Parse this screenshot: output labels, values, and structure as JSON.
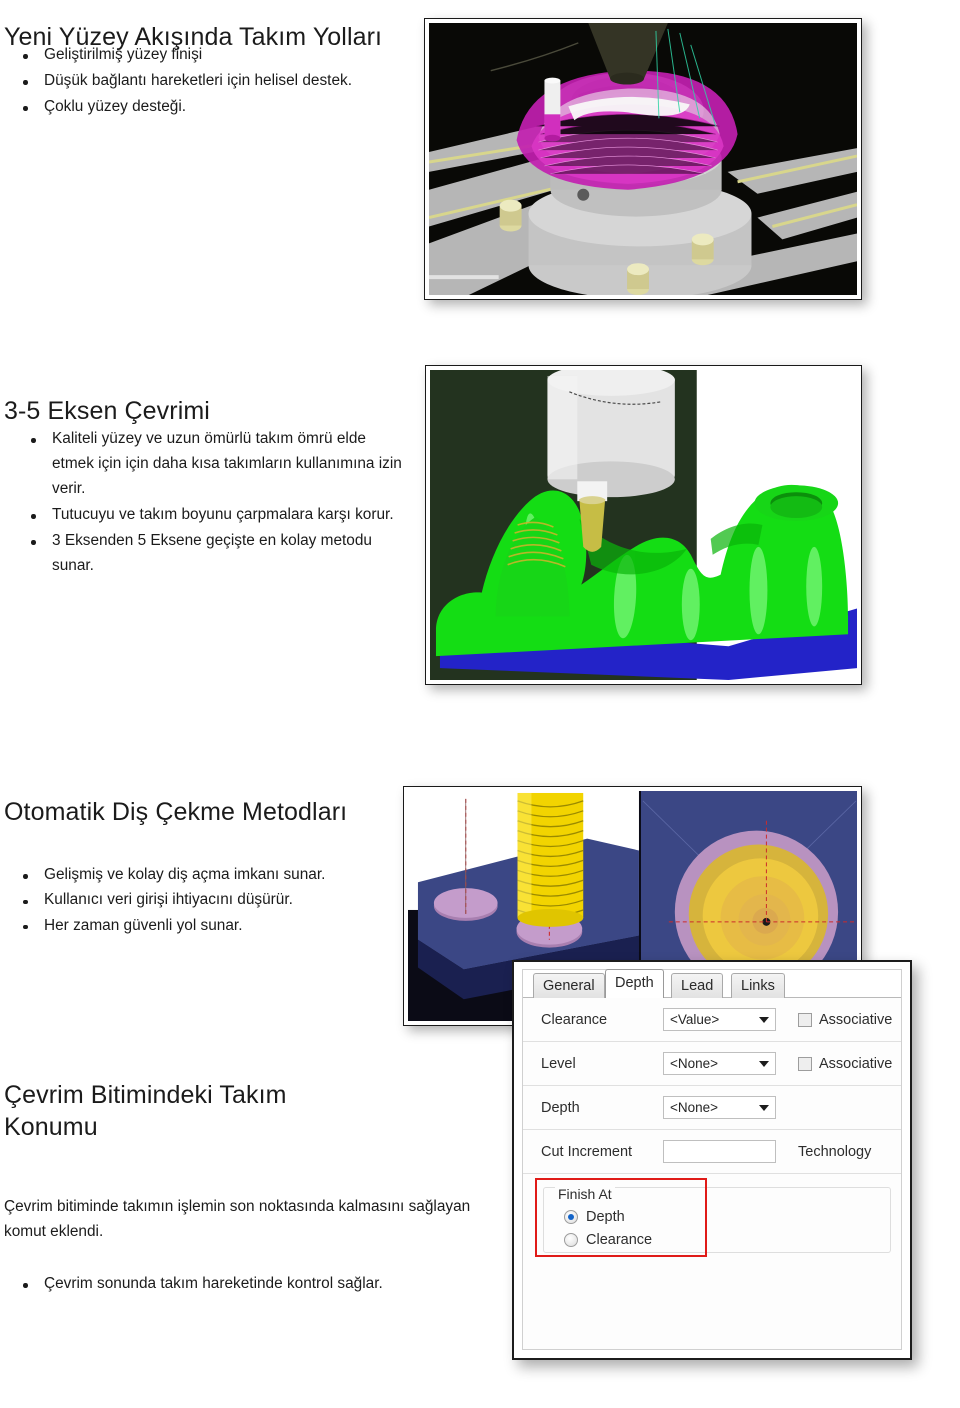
{
  "sections": [
    {
      "id": "surface-flow-toolpaths",
      "heading": "Yeni Yüzey Akışında Takım Yolları",
      "bullets": [
        "Geliştirilmiş yüzey finişi",
        "Düşük bağlantı hareketleri için helisel destek.",
        "Çoklu yüzey desteği."
      ]
    },
    {
      "id": "three-five-axis-cycle",
      "heading": "3-5 Eksen Çevrimi",
      "bullets": [
        "Kaliteli yüzey ve uzun ömürlü takım ömrü elde etmek için için daha kısa takımların kullanımına izin verir.",
        "Tutucuyu ve takım boyunu çarpmalara karşı korur.",
        "3 Eksenden 5 Eksene geçişte en kolay metodu sunar."
      ]
    },
    {
      "id": "automatic-thread-methods",
      "heading": "Otomatik Diş Çekme Metodları",
      "bullets": [
        "Gelişmiş ve kolay diş açma imkanı sunar.",
        "Kullanıcı veri girişi ihtiyacını düşürür.",
        "Her zaman güvenli yol sunar."
      ]
    },
    {
      "id": "tool-position-at-cycle-end",
      "heading": "Çevrim Bitimindeki Takım Konumu",
      "paragraph": "Çevrim bitiminde takımın işlemin son noktasında kalmasını sağlayan komut eklendi.",
      "bullets": [
        "Çevrim sonunda takım hareketinde kontrol sağlar."
      ]
    }
  ],
  "figures": [
    {
      "id": "figure-surface-flow",
      "caption_icon": "cam-toolpath-magenta-render",
      "background": "#0a0a06"
    },
    {
      "id": "figure-5axis-green-part",
      "caption_icon": "cam-green-part-render",
      "background": "#23331f"
    },
    {
      "id": "figure-thread-milling",
      "caption_icon": "cam-thread-milling-render",
      "background": "#3b4785"
    }
  ],
  "dialog": {
    "name": "Depth tab dialog",
    "tabs": [
      {
        "label": "General",
        "active": false
      },
      {
        "label": "Depth",
        "active": true
      },
      {
        "label": "Lead",
        "active": false
      },
      {
        "label": "Links",
        "active": false
      }
    ],
    "rows": [
      {
        "label": "Clearance",
        "control": "combo",
        "value": "<Value>",
        "checkbox_label": "Associative",
        "checked": false
      },
      {
        "label": "Level",
        "control": "combo",
        "value": "<None>",
        "checkbox_label": "Associative",
        "checked": false
      },
      {
        "label": "Depth",
        "control": "combo",
        "value": "<None>",
        "checkbox_label": null,
        "checked": false
      },
      {
        "label": "Cut Increment",
        "control": "textbox",
        "value": "",
        "side_label": "Technology"
      }
    ],
    "finish_at": {
      "title": "Finish At",
      "options": [
        {
          "label": "Depth",
          "selected": true
        },
        {
          "label": "Clearance",
          "selected": false
        }
      ],
      "highlight_color": "#e01b18"
    }
  }
}
